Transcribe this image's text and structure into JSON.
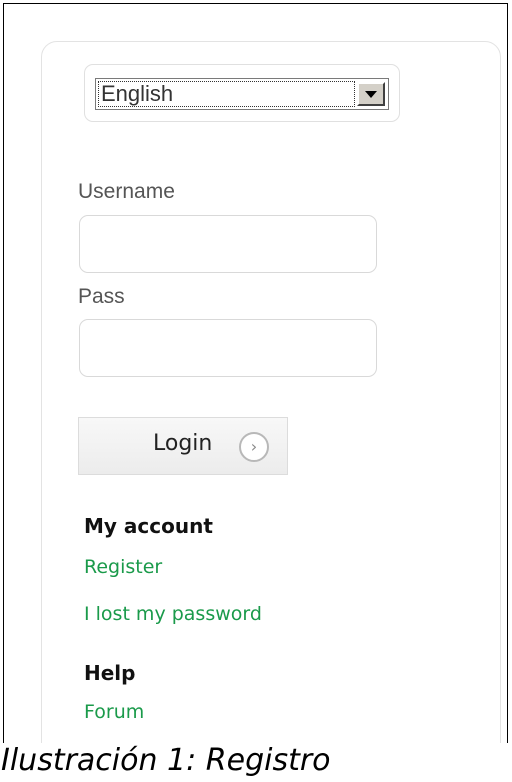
{
  "language_select": {
    "value": "English"
  },
  "login_form": {
    "username_label": "Username",
    "username_value": "",
    "pass_label": "Pass",
    "pass_value": "",
    "login_button_label": "Login"
  },
  "my_account": {
    "title": "My account",
    "register_link": "Register",
    "lost_password_link": "I lost my password"
  },
  "help": {
    "title": "Help",
    "forum_link": "Forum"
  },
  "caption": "Ilustración 1: Registro"
}
